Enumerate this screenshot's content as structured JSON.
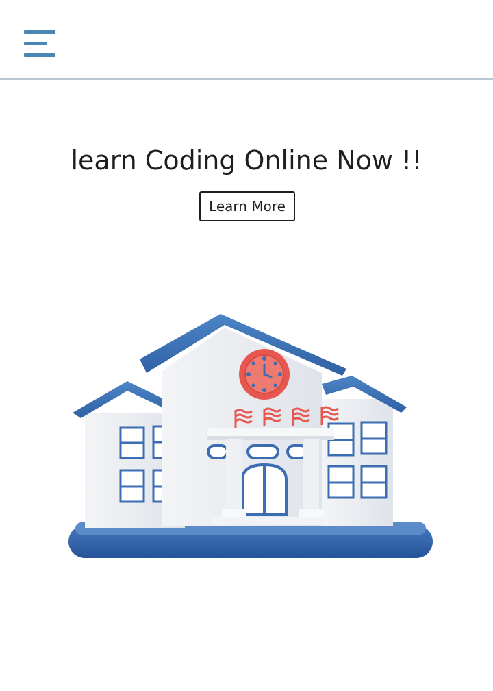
{
  "header": {
    "menu_icon": "hamburger-menu-icon"
  },
  "hero": {
    "title": "learn Coding Online Now !!",
    "cta_label": "Learn More"
  },
  "illustration": {
    "subject": "school-building-illustration"
  },
  "colors": {
    "accent": "#4a86b4",
    "roof": "#3f74b8",
    "clock": "#e8574f",
    "base": "#3a6cb0"
  }
}
